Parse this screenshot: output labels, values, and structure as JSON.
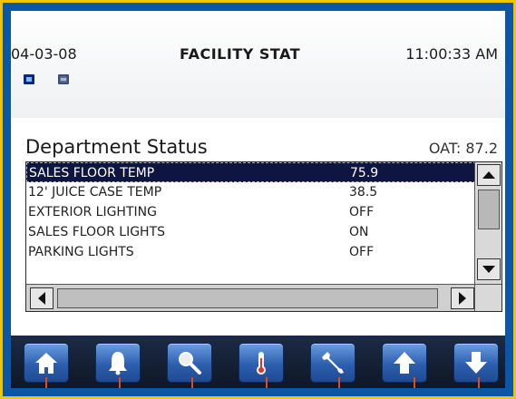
{
  "header": {
    "date": "04-03-08",
    "title": "FACILITY STAT",
    "time": "11:00:33 AM"
  },
  "panel": {
    "title": "Department Status",
    "oat": "OAT: 87.2"
  },
  "list": {
    "rows": [
      {
        "name": "SALES FLOOR TEMP",
        "value": "75.9",
        "selected": true
      },
      {
        "name": "12' JUICE CASE TEMP",
        "value": "38.5",
        "selected": false
      },
      {
        "name": "EXTERIOR LIGHTING",
        "value": "OFF",
        "selected": false
      },
      {
        "name": "SALES FLOOR LIGHTS",
        "value": "ON",
        "selected": false
      },
      {
        "name": "PARKING LIGHTS",
        "value": "OFF",
        "selected": false
      }
    ]
  },
  "toolbar": {
    "buttons": [
      {
        "icon": "home-icon"
      },
      {
        "icon": "bell-icon"
      },
      {
        "icon": "magnifier-icon"
      },
      {
        "icon": "thermometer-icon"
      },
      {
        "icon": "wrench-icon"
      },
      {
        "icon": "arrow-up-icon"
      },
      {
        "icon": "arrow-down-icon"
      }
    ]
  },
  "colors": {
    "bezel": "#0a57a8",
    "bezel_border": "#f2c400",
    "selected_row": "#0e1540",
    "pointer": "#e24a1a"
  }
}
